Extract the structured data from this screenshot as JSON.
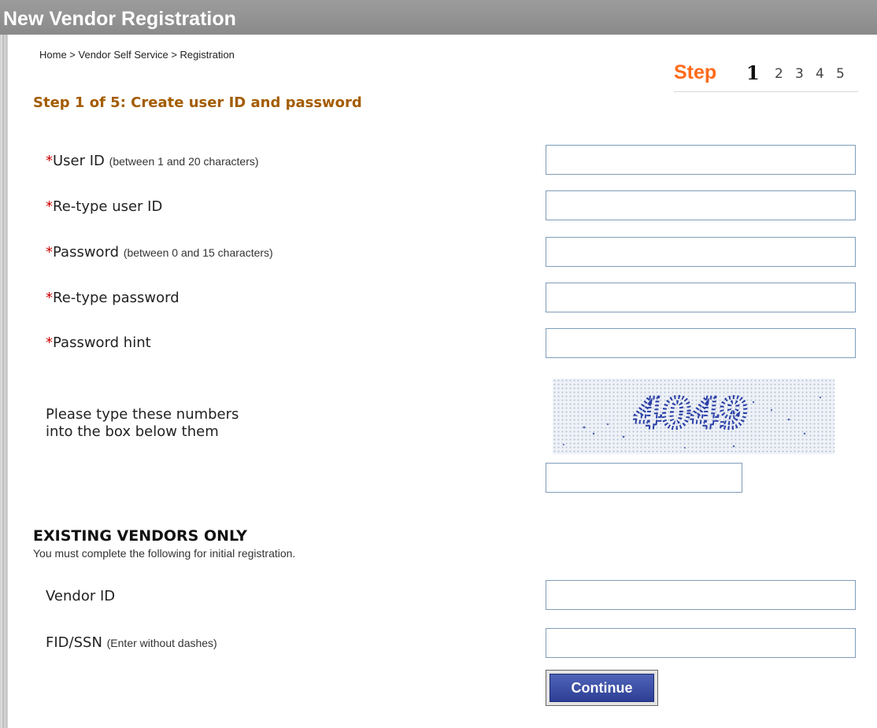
{
  "window": {
    "title": "New Vendor Registration"
  },
  "breadcrumb": {
    "items": [
      "Home",
      "Vendor Self Service",
      "Registration"
    ],
    "separator": " > "
  },
  "steps": {
    "label": "Step",
    "current": "1",
    "others": [
      "2",
      "3",
      "4",
      "5"
    ],
    "accent_color": "#ff6a1a"
  },
  "heading": "Step 1 of 5: Create user ID and password",
  "required_mark": "*",
  "fields": [
    {
      "label": "User ID",
      "hint": "(between 1 and 20 characters)",
      "value": ""
    },
    {
      "label": "Re-type user ID",
      "hint": "",
      "value": ""
    },
    {
      "label": "Password",
      "hint": "(between 0 and 15 characters)",
      "value": ""
    },
    {
      "label": "Re-type password",
      "hint": "",
      "value": ""
    },
    {
      "label": "Password hint",
      "hint": "",
      "value": ""
    }
  ],
  "captcha": {
    "instruction": "Please type these numbers into the box below them",
    "image_text": "4049",
    "value": ""
  },
  "existing_vendors": {
    "title": "EXISTING VENDORS ONLY",
    "note": "You must complete the following for initial registration.",
    "fields": [
      {
        "label": "Vendor ID",
        "hint": "",
        "value": ""
      },
      {
        "label": "FID/SSN",
        "hint": "(Enter without dashes)",
        "value": ""
      }
    ]
  },
  "continue_label": "Continue",
  "colors": {
    "heading": "#a35c00",
    "required": "#cc0000",
    "button": "#2d3f96",
    "title_bar": "#8f8f8f"
  }
}
